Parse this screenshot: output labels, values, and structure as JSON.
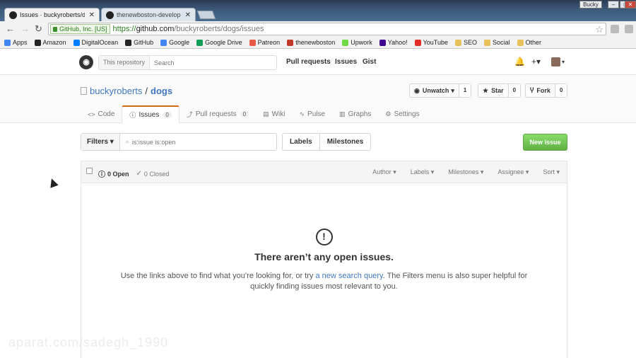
{
  "browser": {
    "tabs": [
      {
        "title": "Issues · buckyroberts/dogs",
        "active": true
      },
      {
        "title": "thenewboston-developers",
        "active": false
      }
    ],
    "profile_name": "Bucky",
    "secure_label": "GitHub, Inc. [US]",
    "url_scheme": "https://",
    "url_host": "github.com",
    "url_path": "/buckyroberts/dogs/issues",
    "bookmarks": [
      {
        "label": "Apps",
        "icon": "apps-grid-icon",
        "color": "#4285f4"
      },
      {
        "label": "Amazon",
        "icon": "amazon-icon",
        "color": "#222222"
      },
      {
        "label": "DigitalOcean",
        "icon": "digitalocean-icon",
        "color": "#0080ff"
      },
      {
        "label": "GitHub",
        "icon": "github-icon",
        "color": "#222222"
      },
      {
        "label": "Google",
        "icon": "google-icon",
        "color": "#4285f4"
      },
      {
        "label": "Google Drive",
        "icon": "google-drive-icon",
        "color": "#0f9d58"
      },
      {
        "label": "Patreon",
        "icon": "patreon-icon",
        "color": "#e85b46"
      },
      {
        "label": "thenewboston",
        "icon": "thenewboston-icon",
        "color": "#c0392b"
      },
      {
        "label": "Upwork",
        "icon": "upwork-icon",
        "color": "#6fda44"
      },
      {
        "label": "Yahoo!",
        "icon": "yahoo-icon",
        "color": "#400090"
      },
      {
        "label": "YouTube",
        "icon": "youtube-icon",
        "color": "#e52d27"
      },
      {
        "label": "SEO",
        "icon": "folder-icon",
        "color": "#e8c15b"
      },
      {
        "label": "Social",
        "icon": "folder-icon",
        "color": "#e8c15b"
      },
      {
        "label": "Other",
        "icon": "folder-icon",
        "color": "#e8c15b"
      }
    ]
  },
  "header": {
    "search_scope": "This repository",
    "search_placeholder": "Search",
    "nav": [
      "Pull requests",
      "Issues",
      "Gist"
    ]
  },
  "repo": {
    "owner": "buckyroberts",
    "name": "dogs",
    "watch_label": "Unwatch",
    "watch_count": "1",
    "star_label": "Star",
    "star_count": "0",
    "fork_label": "Fork",
    "fork_count": "0",
    "tabs": [
      {
        "label": "Code",
        "icon": "code-icon",
        "count": null
      },
      {
        "label": "Issues",
        "icon": "issue-opened-icon",
        "count": "0"
      },
      {
        "label": "Pull requests",
        "icon": "pull-request-icon",
        "count": "0"
      },
      {
        "label": "Wiki",
        "icon": "book-icon",
        "count": null
      },
      {
        "label": "Pulse",
        "icon": "pulse-icon",
        "count": null
      },
      {
        "label": "Graphs",
        "icon": "graph-icon",
        "count": null
      },
      {
        "label": "Settings",
        "icon": "gear-icon",
        "count": null
      }
    ]
  },
  "toolbar": {
    "filters_label": "Filters",
    "filter_query": "is:issue is:open",
    "labels_label": "Labels",
    "milestones_label": "Milestones",
    "new_issue_label": "New issue",
    "accent_green": "#60b044"
  },
  "issues": {
    "open_label": "0 Open",
    "closed_label": "0 Closed",
    "sorters": [
      "Author",
      "Labels",
      "Milestones",
      "Assignee",
      "Sort"
    ],
    "blank_title": "There aren’t any open issues.",
    "blank_text_before": "Use the links above to find what you’re looking for, or try",
    "blank_link": "a new search query",
    "blank_text_after": ". The Filters menu is also super helpful for quickly finding issues most relevant to you."
  },
  "watermark": "aparat.com/sadegh_1990"
}
